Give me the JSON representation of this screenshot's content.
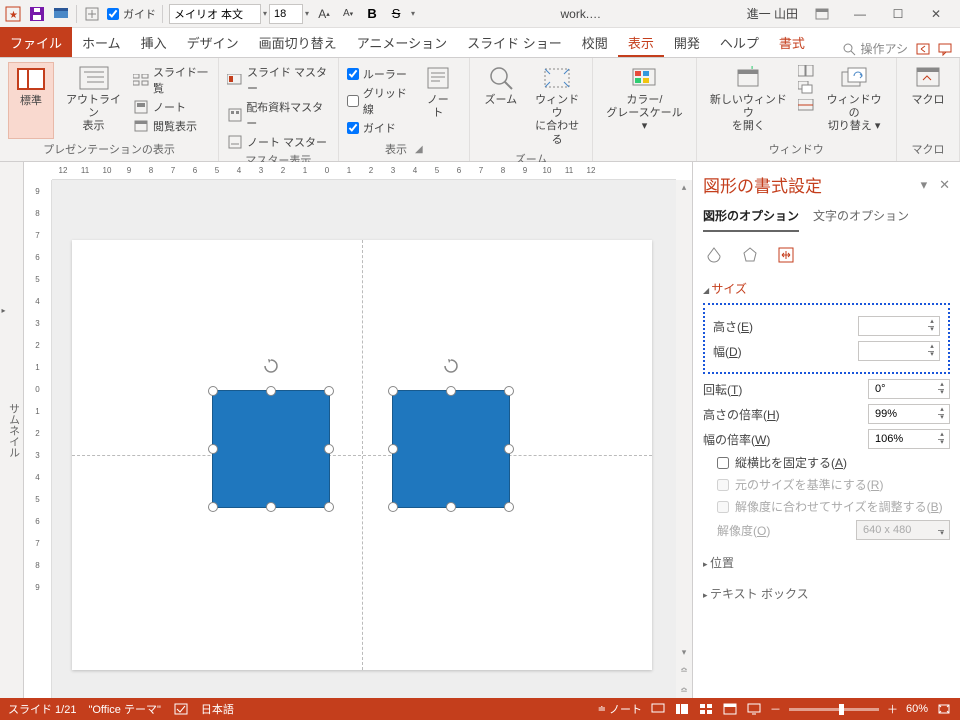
{
  "qat": {
    "guide_label": "ガイド",
    "font_name": "メイリオ 本文",
    "font_size": "18"
  },
  "titlebar": {
    "filename": "work.…",
    "user": "進一 山田"
  },
  "tabs": {
    "file": "ファイル",
    "home": "ホーム",
    "insert": "挿入",
    "design": "デザイン",
    "transitions": "画面切り替え",
    "animations": "アニメーション",
    "slideshow": "スライド ショー",
    "review": "校閲",
    "view": "表示",
    "developer": "開発",
    "help": "ヘルプ",
    "format": "書式",
    "search": "操作アシ"
  },
  "ribbon": {
    "presentation_views": {
      "normal": "標準",
      "outline": "アウトライン\n表示",
      "slidesorter": "スライド一覧",
      "notes": "ノート",
      "reading": "閲覧表示",
      "group": "プレゼンテーションの表示"
    },
    "master_views": {
      "slide": "スライド マスター",
      "handout": "配布資料マスター",
      "notes": "ノート マスター",
      "group": "マスター表示"
    },
    "show": {
      "ruler": "ルーラー",
      "grid": "グリッド線",
      "guide": "ガイド",
      "notes_btn": "ノー\nト",
      "group": "表示"
    },
    "zoom": {
      "zoom": "ズーム",
      "fit": "ウィンドウ\nに合わせる",
      "group": "ズーム"
    },
    "color": {
      "color": "カラー/\nグレースケール ▾",
      "group": " "
    },
    "window": {
      "new": "新しいウィンドウ\nを開く",
      "switch": "ウィンドウの\n切り替え ▾",
      "group": "ウィンドウ"
    },
    "macro": {
      "macro": "マクロ",
      "group": "マクロ"
    }
  },
  "thumbnail": "サムネイル",
  "ruler_h": [
    "12",
    "11",
    "10",
    "9",
    "8",
    "7",
    "6",
    "5",
    "4",
    "3",
    "2",
    "1",
    "0",
    "1",
    "2",
    "3",
    "4",
    "5",
    "6",
    "7",
    "8",
    "9",
    "10",
    "11",
    "12"
  ],
  "ruler_v": [
    "9",
    "8",
    "7",
    "6",
    "5",
    "4",
    "3",
    "2",
    "1",
    "0",
    "1",
    "2",
    "3",
    "4",
    "5",
    "6",
    "7",
    "8",
    "9"
  ],
  "pane": {
    "title": "図形の書式設定",
    "tab_shape": "図形のオプション",
    "tab_text": "文字のオプション",
    "size_head": "サイズ",
    "height": "高さ(E)",
    "width": "幅(D)",
    "rotation": "回転(T)",
    "rotation_val": "0°",
    "scale_h": "高さの倍率(H)",
    "scale_h_val": "99%",
    "scale_w": "幅の倍率(W)",
    "scale_w_val": "106%",
    "lock_aspect": "縦横比を固定する(A)",
    "relative_orig": "元のサイズを基準にする(R)",
    "match_res": "解像度に合わせてサイズを調整する(B)",
    "resolution": "解像度(O)",
    "resolution_val": "640 x 480",
    "position_head": "位置",
    "textbox_head": "テキスト ボックス"
  },
  "statusbar": {
    "slide": "スライド 1/21",
    "theme": "\"Office テーマ\"",
    "lang": "日本語",
    "notes": "ノート",
    "zoom": "60%"
  }
}
